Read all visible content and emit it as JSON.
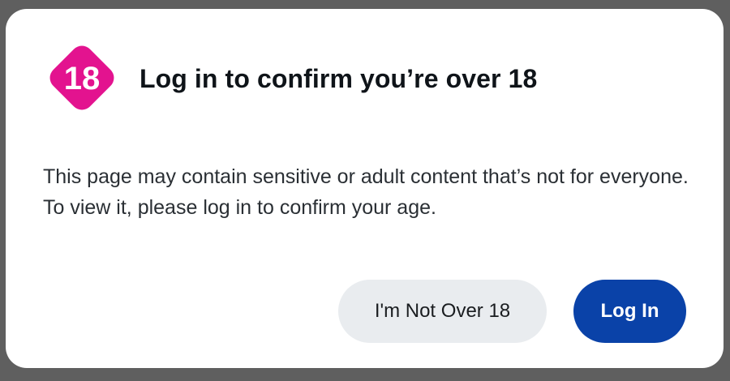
{
  "dialog": {
    "badge_text": "18",
    "badge_color": "#e3138f",
    "title": "Log in to confirm you’re over 18",
    "message": "This page may contain sensitive or adult content that’s not for everyone. To view it, please log in to confirm your age.",
    "secondary_button": "I'm Not Over 18",
    "primary_button": "Log In",
    "primary_color": "#0a42a8",
    "secondary_color": "#e9ecef"
  }
}
